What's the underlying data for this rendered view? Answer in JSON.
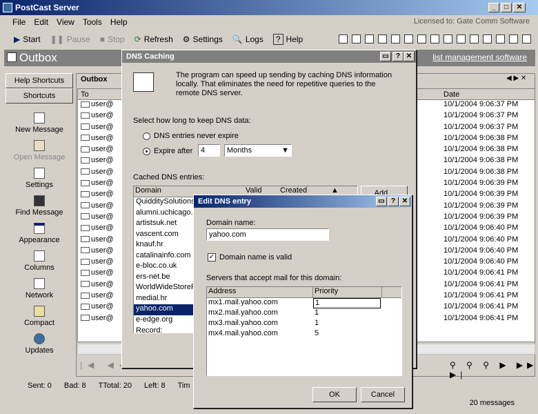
{
  "window": {
    "title": "PostCast Server"
  },
  "menu": [
    "File",
    "Edit",
    "View",
    "Tools",
    "Help"
  ],
  "licensed": "Licensed to: Gate Comm Software",
  "toolbar": {
    "start": "Start",
    "pause": "Pause",
    "stop": "Stop",
    "refresh": "Refresh",
    "settings": "Settings",
    "logs": "Logs",
    "help": "Help"
  },
  "banner": {
    "title": "Outbox",
    "link": "list management software"
  },
  "sidebar": {
    "tabs": [
      "Help Shortcuts",
      "Shortcuts"
    ],
    "items": [
      "New Message",
      "Open Message",
      "Settings",
      "Find Message",
      "Appearance",
      "Columns",
      "Network",
      "Compact",
      "Updates"
    ]
  },
  "outbox": {
    "tab": "Outbox",
    "col_to": "To",
    "col_date": "Date",
    "rows": [
      {
        "to": "user@",
        "date": "10/1/2004 9:06:37 PM"
      },
      {
        "to": "user@",
        "date": "10/1/2004 9:06:37 PM"
      },
      {
        "to": "user@",
        "date": "10/1/2004 9:06:37 PM"
      },
      {
        "to": "user@",
        "date": "10/1/2004 9:06:38 PM"
      },
      {
        "to": "user@",
        "date": "10/1/2004 9:06:38 PM"
      },
      {
        "to": "user@",
        "date": "10/1/2004 9:06:38 PM"
      },
      {
        "to": "user@",
        "date": "10/1/2004 9:06:38 PM"
      },
      {
        "to": "user@",
        "date": "10/1/2004 9:06:39 PM"
      },
      {
        "to": "user@",
        "date": "10/1/2004 9:06:39 PM"
      },
      {
        "to": "user@",
        "date": "10/1/2004 9:06:39 PM"
      },
      {
        "to": "user@",
        "date": "10/1/2004 9:06:39 PM"
      },
      {
        "to": "user@",
        "date": "10/1/2004 9:06:40 PM"
      },
      {
        "to": "user@",
        "date": "10/1/2004 9:06:40 PM"
      },
      {
        "to": "user@",
        "date": "10/1/2004 9:06:40 PM"
      },
      {
        "to": "user@",
        "date": "10/1/2004 9:06:40 PM"
      },
      {
        "to": "user@",
        "date": "10/1/2004 9:06:41 PM"
      },
      {
        "to": "user@",
        "date": "10/1/2004 9:06:41 PM"
      },
      {
        "to": "user@",
        "date": "10/1/2004 9:06:41 PM"
      },
      {
        "to": "user@",
        "date": "10/1/2004 9:06:41 PM"
      },
      {
        "to": "user@",
        "date": "10/1/2004 9:06:41 PM"
      }
    ]
  },
  "status": {
    "sent": "Sent: 0",
    "bad": "Bad: 8",
    "total": "TTotal: 20",
    "left": "Left: 8",
    "time": "Tim",
    "messages": "20 messages"
  },
  "dns_dialog": {
    "title": "DNS Caching",
    "description": "The program can speed up sending by caching DNS information locally. That eliminates the need for repetitive queries to the remote DNS server.",
    "keep_label": "Select how long to keep DNS data:",
    "radio_never": "DNS entries never expire",
    "radio_expire": "Expire after",
    "expire_value": "4",
    "expire_unit": "Months",
    "cached_label": "Cached DNS entries:",
    "col_domain": "Domain",
    "col_valid": "Valid",
    "col_created": "Created",
    "add_button": "Add...",
    "record_label": "Record:",
    "entries": [
      "QuidditySolutions.c",
      "alumni.uchicago.e",
      "artistsuk.net",
      "vascent.com",
      "knauf.hr",
      "catalinainfo.com",
      "e-bloc.co.uk",
      "ers-net.be",
      "WorldWideStoreFr",
      "medial.hr",
      "yahoo.com",
      "e-edge.org"
    ],
    "selected_entry": "yahoo.com"
  },
  "edit_dialog": {
    "title": "Edit DNS entry",
    "domain_label": "Domain name:",
    "domain_value": "yahoo.com",
    "valid_label": "Domain name is valid",
    "servers_label": "Servers that accept mail for this domain:",
    "col_address": "Address",
    "col_priority": "Priority",
    "servers": [
      {
        "address": "mx1.mail.yahoo.com",
        "priority": "1"
      },
      {
        "address": "mx2.mail.yahoo.com",
        "priority": "1"
      },
      {
        "address": "mx3.mail.yahoo.com",
        "priority": "1"
      },
      {
        "address": "mx4.mail.yahoo.com",
        "priority": "5"
      }
    ],
    "ok": "OK",
    "cancel": "Cancel"
  }
}
